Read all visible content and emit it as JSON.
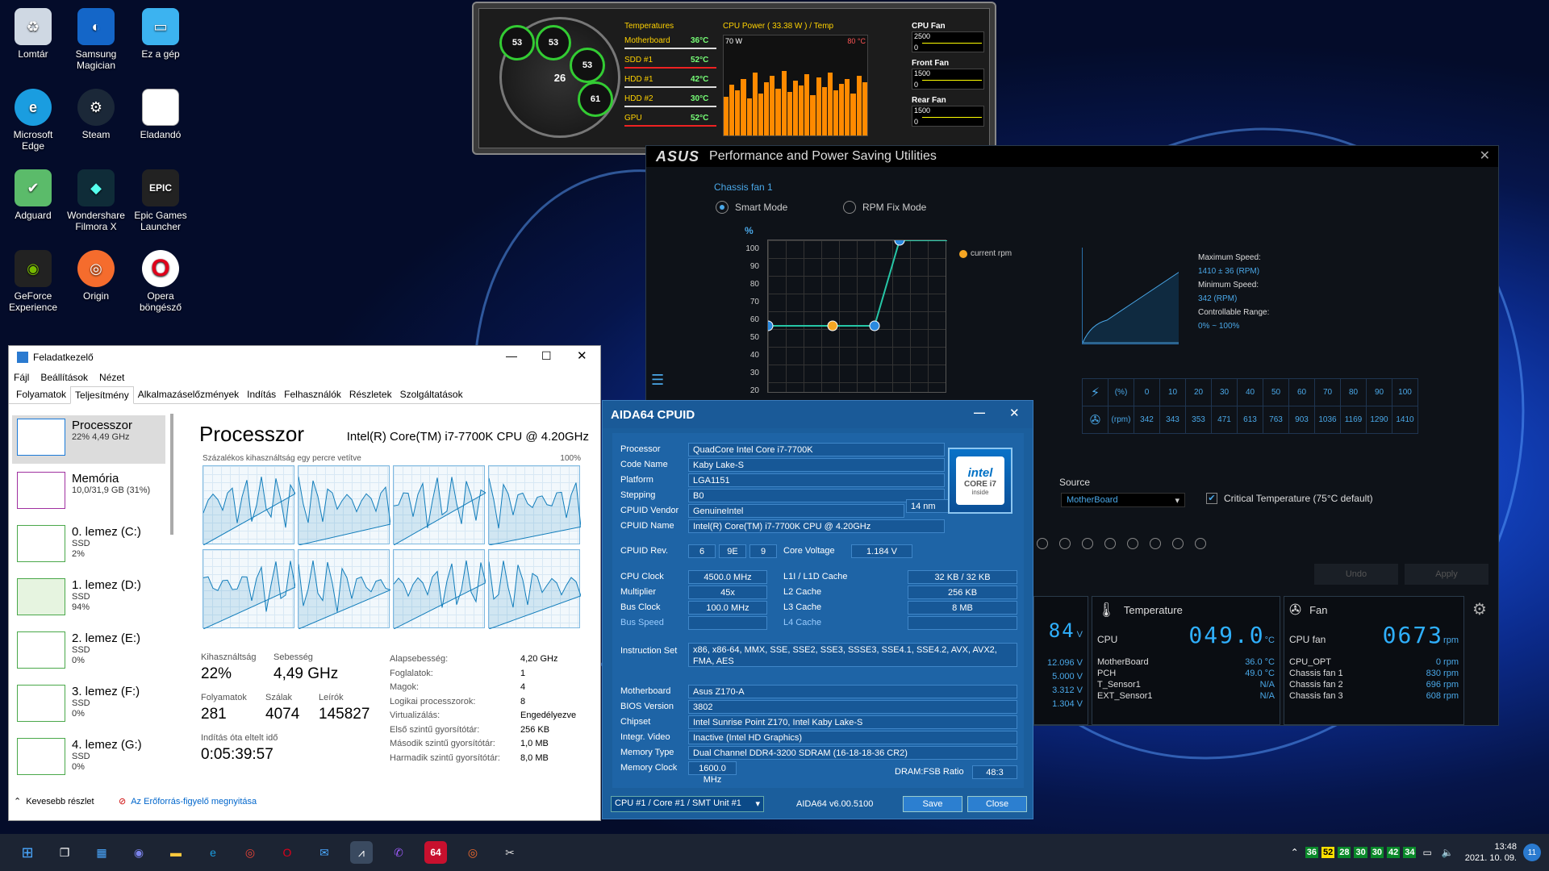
{
  "desktop": {
    "icons": [
      {
        "label": "Lomtár",
        "icon": "recycle-bin-icon"
      },
      {
        "label": "Samsung Magician",
        "icon": "samsung-magician-icon"
      },
      {
        "label": "Ez a gép",
        "icon": "this-pc-icon"
      },
      {
        "label": "Microsoft Edge",
        "icon": "edge-icon"
      },
      {
        "label": "Steam",
        "icon": "steam-icon"
      },
      {
        "label": "Eladandó",
        "icon": "document-icon"
      },
      {
        "label": "Adguard",
        "icon": "adguard-icon"
      },
      {
        "label": "Wondershare Filmora X",
        "icon": "filmora-icon"
      },
      {
        "label": "Epic Games Launcher",
        "icon": "epic-games-icon"
      },
      {
        "label": "GeForce Experience",
        "icon": "geforce-icon"
      },
      {
        "label": "Origin",
        "icon": "origin-icon"
      },
      {
        "label": "Opera böngésző",
        "icon": "opera-icon"
      }
    ]
  },
  "temp_widget": {
    "gauges": [
      "53",
      "53",
      "53",
      "26",
      "61"
    ],
    "temps_header": "Temperatures",
    "sensors": [
      {
        "name": "Motherboard",
        "value": "36°C"
      },
      {
        "name": "SDD #1",
        "value": "52°C"
      },
      {
        "name": "HDD #1",
        "value": "42°C"
      },
      {
        "name": "HDD #2",
        "value": "30°C"
      },
      {
        "name": "GPU",
        "value": "52°C"
      }
    ],
    "cpu_power_header": "CPU Power ( 33.38 W ) / Temp",
    "power_max": "70 W",
    "temp_max": "80 °C",
    "fans": [
      {
        "name": "CPU Fan",
        "top": "2500",
        "bottom": "0"
      },
      {
        "name": "Front Fan",
        "top": "1500",
        "bottom": "0"
      },
      {
        "name": "Rear Fan",
        "top": "1500",
        "bottom": "0"
      }
    ],
    "colors": {
      "label": "#ffd200",
      "value": "#77ff77",
      "power": "#ff8a00"
    }
  },
  "asus": {
    "title": "Performance and Power Saving Utilities",
    "logo": "ASUS",
    "fan_name": "Chassis fan 1",
    "mode_smart": "Smart Mode",
    "mode_rpm": "RPM Fix Mode",
    "y_unit": "%",
    "y_ticks": [
      "100",
      "90",
      "80",
      "70",
      "60",
      "50",
      "40",
      "30",
      "20"
    ],
    "legend": "current rpm",
    "max_speed_label": "Maximum Speed:",
    "max_speed": "1410 ± 36 (RPM)",
    "min_speed_label": "Minimum Speed:",
    "min_speed": "342 (RPM)",
    "range_label": "Controllable Range:",
    "range": "0% ~ 100%",
    "pct_unit": "(%)",
    "rpm_unit": "(rpm)",
    "pct_row": [
      "0",
      "10",
      "20",
      "30",
      "40",
      "50",
      "60",
      "70",
      "80",
      "90",
      "100"
    ],
    "rpm_row": [
      "342",
      "343",
      "353",
      "471",
      "613",
      "763",
      "903",
      "1036",
      "1169",
      "1290",
      "1410"
    ],
    "source_label": "Source",
    "source_value": "MotherBoard",
    "critical_label": "Critical Temperature (75°C default)",
    "undo": "Undo",
    "apply": "Apply",
    "volt_lcd": "84",
    "volt_unit": "V",
    "volts": [
      "12.096 V",
      "5.000 V",
      "3.312 V",
      "1.304 V"
    ],
    "temp_panel": {
      "title": "Temperature",
      "main_label": "CPU",
      "main_value": "049.0",
      "unit": "°C",
      "rows": [
        {
          "name": "MotherBoard",
          "value": "36.0 °C"
        },
        {
          "name": "PCH",
          "value": "49.0 °C"
        },
        {
          "name": "T_Sensor1",
          "value": "N/A"
        },
        {
          "name": "EXT_Sensor1",
          "value": "N/A"
        }
      ]
    },
    "fan_panel": {
      "title": "Fan",
      "main_label": "CPU fan",
      "main_value": "0673",
      "unit": "rpm",
      "rows": [
        {
          "name": "CPU_OPT",
          "value": "0",
          "unit": "rpm"
        },
        {
          "name": "Chassis fan 1",
          "value": "830",
          "unit": "rpm"
        },
        {
          "name": "Chassis fan 2",
          "value": "696",
          "unit": "rpm"
        },
        {
          "name": "Chassis fan 3",
          "value": "608",
          "unit": "rpm"
        }
      ]
    }
  },
  "taskmgr": {
    "title": "Feladatkezelő",
    "menu": [
      "Fájl",
      "Beállítások",
      "Nézet"
    ],
    "tabs": [
      "Folyamatok",
      "Teljesítmény",
      "Alkalmazáselőzmények",
      "Indítás",
      "Felhasználók",
      "Részletek",
      "Szolgáltatások"
    ],
    "side": [
      {
        "name": "Processzor",
        "sub1": "22% 4,49 GHz",
        "sub2": "",
        "sub3": ""
      },
      {
        "name": "Memória",
        "sub1": "10,0/31,9 GB (31%)",
        "sub2": "",
        "sub3": ""
      },
      {
        "name": "0. lemez (C:)",
        "sub1": "SSD",
        "sub2": "2%",
        "sub3": ""
      },
      {
        "name": "1. lemez (D:)",
        "sub1": "SSD",
        "sub2": "94%",
        "sub3": ""
      },
      {
        "name": "2. lemez (E:)",
        "sub1": "SSD",
        "sub2": "0%",
        "sub3": ""
      },
      {
        "name": "3. lemez (F:)",
        "sub1": "SSD",
        "sub2": "0%",
        "sub3": ""
      },
      {
        "name": "4. lemez (G:)",
        "sub1": "SSD",
        "sub2": "0%",
        "sub3": ""
      }
    ],
    "heading": "Processzor",
    "cpu_model": "Intel(R) Core(TM) i7-7700K CPU @ 4.20GHz",
    "graph_caption": "Százalékos kihasználtság egy percre vetítve",
    "graph_max": "100%",
    "stats": {
      "util_label": "Kihasználtság",
      "util": "22%",
      "speed_label": "Sebesség",
      "speed": "4,49 GHz",
      "proc_label": "Folyamatok",
      "proc": "281",
      "threads_label": "Szálak",
      "threads": "4074",
      "handles_label": "Leírók",
      "handles": "145827",
      "uptime_label": "Indítás óta eltelt idő",
      "uptime": "0:05:39:57"
    },
    "details": [
      {
        "k": "Alapsebesség:",
        "v": "4,20 GHz"
      },
      {
        "k": "Foglalatok:",
        "v": "1"
      },
      {
        "k": "Magok:",
        "v": "4"
      },
      {
        "k": "Logikai processzorok:",
        "v": "8"
      },
      {
        "k": "Virtualizálás:",
        "v": "Engedélyezve"
      },
      {
        "k": "Első szintű gyorsítótár:",
        "v": "256 KB"
      },
      {
        "k": "Második szintű gyorsítótár:",
        "v": "1,0 MB"
      },
      {
        "k": "Harmadik szintű gyorsítótár:",
        "v": "8,0 MB"
      }
    ],
    "fewer": "Kevesebb részlet",
    "resmon": "Az Erőforrás-figyelő megnyitása"
  },
  "aida": {
    "title": "AIDA64 CPUID",
    "fields": [
      {
        "k": "Processor",
        "v": "QuadCore Intel Core i7-7700K"
      },
      {
        "k": "Code Name",
        "v": "Kaby Lake-S"
      },
      {
        "k": "Platform",
        "v": "LGA1151"
      },
      {
        "k": "Stepping",
        "v": "B0"
      },
      {
        "k": "CPUID Vendor",
        "v": "GenuineIntel"
      },
      {
        "k": "CPUID Name",
        "v": "Intel(R) Core(TM) i7-7700K CPU @ 4.20GHz"
      }
    ],
    "process": "14 nm",
    "cpuid_rev_label": "CPUID Rev.",
    "cpuid_rev": [
      "6",
      "9E",
      "9"
    ],
    "core_voltage_label": "Core Voltage",
    "core_voltage": "1.184 V",
    "clocks": [
      {
        "k": "CPU Clock",
        "v": "4500.0 MHz"
      },
      {
        "k": "Multiplier",
        "v": "45x"
      },
      {
        "k": "Bus Clock",
        "v": "100.0 MHz"
      },
      {
        "k": "Bus Speed",
        "v": ""
      }
    ],
    "caches": [
      {
        "k": "L1I / L1D Cache",
        "v": "32 KB / 32 KB"
      },
      {
        "k": "L2 Cache",
        "v": "256 KB"
      },
      {
        "k": "L3 Cache",
        "v": "8 MB"
      },
      {
        "k": "L4 Cache",
        "v": ""
      }
    ],
    "iset_label": "Instruction Set",
    "iset": "x86, x86-64, MMX, SSE, SSE2, SSE3, SSSE3, SSE4.1, SSE4.2, AVX, AVX2, FMA, AES",
    "board": [
      {
        "k": "Motherboard",
        "v": "Asus Z170-A"
      },
      {
        "k": "BIOS Version",
        "v": "3802"
      },
      {
        "k": "Chipset",
        "v": "Intel Sunrise Point Z170, Intel Kaby Lake-S"
      },
      {
        "k": "Integr. Video",
        "v": "Inactive  (Intel HD Graphics)"
      },
      {
        "k": "Memory Type",
        "v": "Dual Channel DDR4-3200 SDRAM  (16-18-18-36 CR2)"
      },
      {
        "k": "Memory Clock",
        "v": "1600.0 MHz"
      }
    ],
    "ratio_label": "DRAM:FSB Ratio",
    "ratio": "48:3",
    "core_select": "CPU #1 / Core #1 / SMT Unit #1",
    "version": "AIDA64 v6.00.5100",
    "save": "Save",
    "close": "Close",
    "intel_logo": "intel",
    "intel_brand": "CORE i7",
    "intel_inside": "inside"
  },
  "taskbar": {
    "tray_nums": [
      "36",
      "52",
      "28",
      "30",
      "30",
      "42",
      "34"
    ],
    "time": "13:48",
    "date": "2021. 10. 09.",
    "notif": "11"
  }
}
